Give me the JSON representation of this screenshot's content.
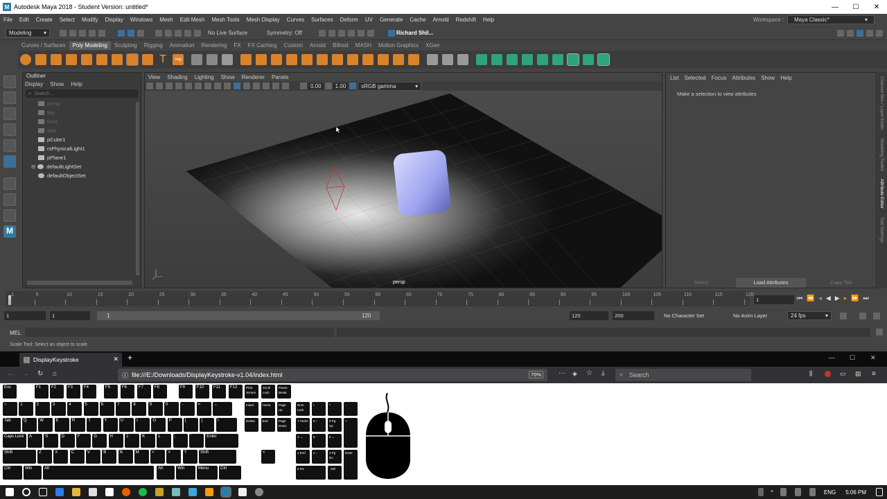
{
  "window": {
    "title": "Autodesk Maya 2018 - Student Version: untitled*"
  },
  "menubar": [
    "File",
    "Edit",
    "Create",
    "Select",
    "Modify",
    "Display",
    "Windows",
    "Mesh",
    "Edit Mesh",
    "Mesh Tools",
    "Mesh Display",
    "Curves",
    "Surfaces",
    "Deform",
    "UV",
    "Generate",
    "Cache",
    "Arnold",
    "Redshift",
    "Help"
  ],
  "workspace": {
    "label": "Workspace :",
    "value": "Maya Classic*"
  },
  "statusline": {
    "mode": "Modeling",
    "live_surface": "No Live Surface",
    "symmetry": "Symmetry: Off",
    "user": "Richard Shil..."
  },
  "shelf_tabs": [
    "Curves / Surfaces",
    "Poly Modeling",
    "Sculpting",
    "Rigging",
    "Animation",
    "Rendering",
    "FX",
    "FX Caching",
    "Custom",
    "Arnold",
    "Bifrost",
    "MASH",
    "Motion Graphics",
    "XGen"
  ],
  "shelf_active": "Poly Modeling",
  "outliner": {
    "title": "Outliner",
    "menu": [
      "Display",
      "Show",
      "Help"
    ],
    "search_placeholder": "Search...",
    "items": [
      {
        "label": "persp",
        "dim": true
      },
      {
        "label": "top",
        "dim": true
      },
      {
        "label": "front",
        "dim": true
      },
      {
        "label": "side",
        "dim": true
      },
      {
        "label": "pCube1",
        "dim": false
      },
      {
        "label": "rsPhysicalLight1",
        "dim": false
      },
      {
        "label": "pPlane1",
        "dim": false
      },
      {
        "label": "defaultLightSet",
        "dim": false
      },
      {
        "label": "defaultObjectSet",
        "dim": false
      }
    ]
  },
  "viewport": {
    "menu": [
      "View",
      "Shading",
      "Lighting",
      "Show",
      "Renderer",
      "Panels"
    ],
    "exposure": "0.00",
    "gamma": "1.00",
    "colorspace": "sRGB gamma",
    "camera": "persp"
  },
  "attribute_editor": {
    "menu": [
      "List",
      "Selected",
      "Focus",
      "Attributes",
      "Show",
      "Help"
    ],
    "message": "Make a selection to view attributes",
    "buttons": [
      "Select",
      "Load Attributes",
      "Copy Tab"
    ]
  },
  "side_tabs": [
    "Channel Box / Layer Editor",
    "Modeling Toolkit",
    "Attribute Editor",
    "Tool Settings"
  ],
  "timeline": {
    "ticks": [
      "1",
      "5",
      "10",
      "15",
      "20",
      "25",
      "30",
      "35",
      "40",
      "45",
      "50",
      "55",
      "60",
      "65",
      "70",
      "75",
      "80",
      "85",
      "90",
      "95",
      "100",
      "105",
      "110",
      "115",
      "120"
    ],
    "current": "1"
  },
  "range": {
    "start": "1",
    "playback_start": "1",
    "slider_start": "1",
    "slider_end": "120",
    "end": "120",
    "anim_end": "200",
    "character_set": "No Character Set",
    "anim_layer": "No Anim Layer",
    "fps": "24 fps"
  },
  "mel": {
    "label": "MEL"
  },
  "helpline": "Scale Tool: Select an object to scale.",
  "firefox": {
    "tab_title": "DisplayKeystroke",
    "url": "file:///E:/Downloads/DisplayKeystroke-v1.04/index.html",
    "zoom": "70%",
    "search_placeholder": "Search"
  },
  "keyboard": {
    "fn_row": [
      "Esc",
      "F1",
      "F2",
      "F3",
      "F4",
      "F5",
      "F6",
      "F7",
      "F8",
      "F9",
      "F10",
      "F11",
      "F12",
      "Print Screen",
      "Scroll Lock",
      "Pause Break"
    ],
    "num_row": [
      "~",
      "1",
      "2",
      "3",
      "4",
      "5",
      "6",
      "7",
      "8",
      "9",
      "0",
      "-",
      "=",
      "←"
    ],
    "q_row": [
      "Tab",
      "Q",
      "W",
      "E",
      "R",
      "T",
      "Y",
      "U",
      "I",
      "O",
      "P",
      "[",
      "]",
      "\\"
    ],
    "a_row": [
      "Caps Lock",
      "A",
      "S",
      "D",
      "F",
      "G",
      "H",
      "J",
      "K",
      "L",
      ";",
      "'",
      "Enter"
    ],
    "z_row": [
      "Shift",
      "Z",
      "X",
      "C",
      "V",
      "B",
      "N",
      "M",
      "<",
      ">",
      "?",
      "Shift"
    ],
    "bottom_row": [
      "Ctrl",
      "Win",
      "Alt",
      "Alt",
      "Win",
      "Menu",
      "Ctrl"
    ],
    "nav": [
      "Insert",
      "Home",
      "Page Up",
      "Delete",
      "End",
      "Page Down"
    ],
    "numpad": [
      "Num Lock",
      "/",
      "*",
      "-",
      "7 Home",
      "8 ↑",
      "9 Pg Up",
      "+",
      "4 ←",
      "5",
      "6 →",
      "1 End",
      "2 ↓",
      "3 Pg Dn",
      "Enter",
      "0 Ins",
      ". Del"
    ]
  },
  "taskbar": {
    "lang": "ENG",
    "time": "5:06 PM"
  }
}
